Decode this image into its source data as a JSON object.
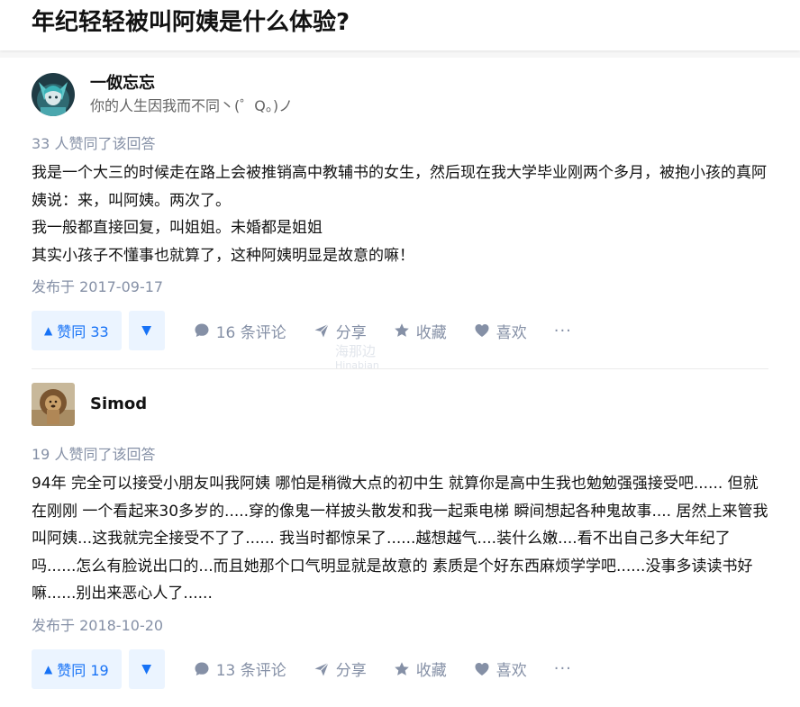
{
  "question": {
    "title": "年纪轻轻被叫阿姨是什么体验?"
  },
  "answers": [
    {
      "author_name": "一伮忘忘",
      "author_bio": "你的人生因我而不同丶(゜Q。)ノ",
      "avatar_icon": "anime-character-avatar",
      "vote_text": "33 人赞同了该回答",
      "paragraphs": [
        "我是一个大三的时候走在路上会被推销高中教辅书的女生，然后现在我大学毕业刚两个多月，被抱小孩的真阿姨说：来，叫阿姨。两次了。",
        "我一般都直接回复，叫姐姐。未婚都是姐姐",
        "其实小孩子不懂事也就算了，这种阿姨明显是故意的嘛！"
      ],
      "published": "发布于 2017-09-17",
      "upvote_label": "赞同 33",
      "comments_label": "16 条评论",
      "share_label": "分享",
      "collect_label": "收藏",
      "like_label": "喜欢",
      "more_label": "···"
    },
    {
      "author_name": "Simod",
      "author_bio": "",
      "avatar_icon": "lion-avatar",
      "vote_text": "19 人赞同了该回答",
      "paragraphs": [
        "94年 完全可以接受小朋友叫我阿姨 哪怕是稍微大点的初中生 就算你是高中生我也勉勉强强接受吧...... 但就在刚刚 一个看起来30多岁的.....穿的像鬼一样披头散发和我一起乘电梯 瞬间想起各种鬼故事.... 居然上来管我叫阿姨...这我就完全接受不了了...... 我当时都惊呆了......越想越气....装什么嫩....看不出自己多大年纪了吗......怎么有脸说出口的...而且她那个口气明显就是故意的 素质是个好东西麻烦学学吧......没事多读读书好嘛......别出来恶心人了......"
      ],
      "published": "发布于 2018-10-20",
      "upvote_label": "赞同 19",
      "comments_label": "13 条评论",
      "share_label": "分享",
      "collect_label": "收藏",
      "like_label": "喜欢",
      "more_label": "···"
    }
  ],
  "colors": {
    "accent": "#1772f6",
    "accent_bg": "#ebf4ff",
    "meta": "#8590a6"
  },
  "watermark": {
    "cn": "海那边",
    "en": "Hinabian"
  }
}
